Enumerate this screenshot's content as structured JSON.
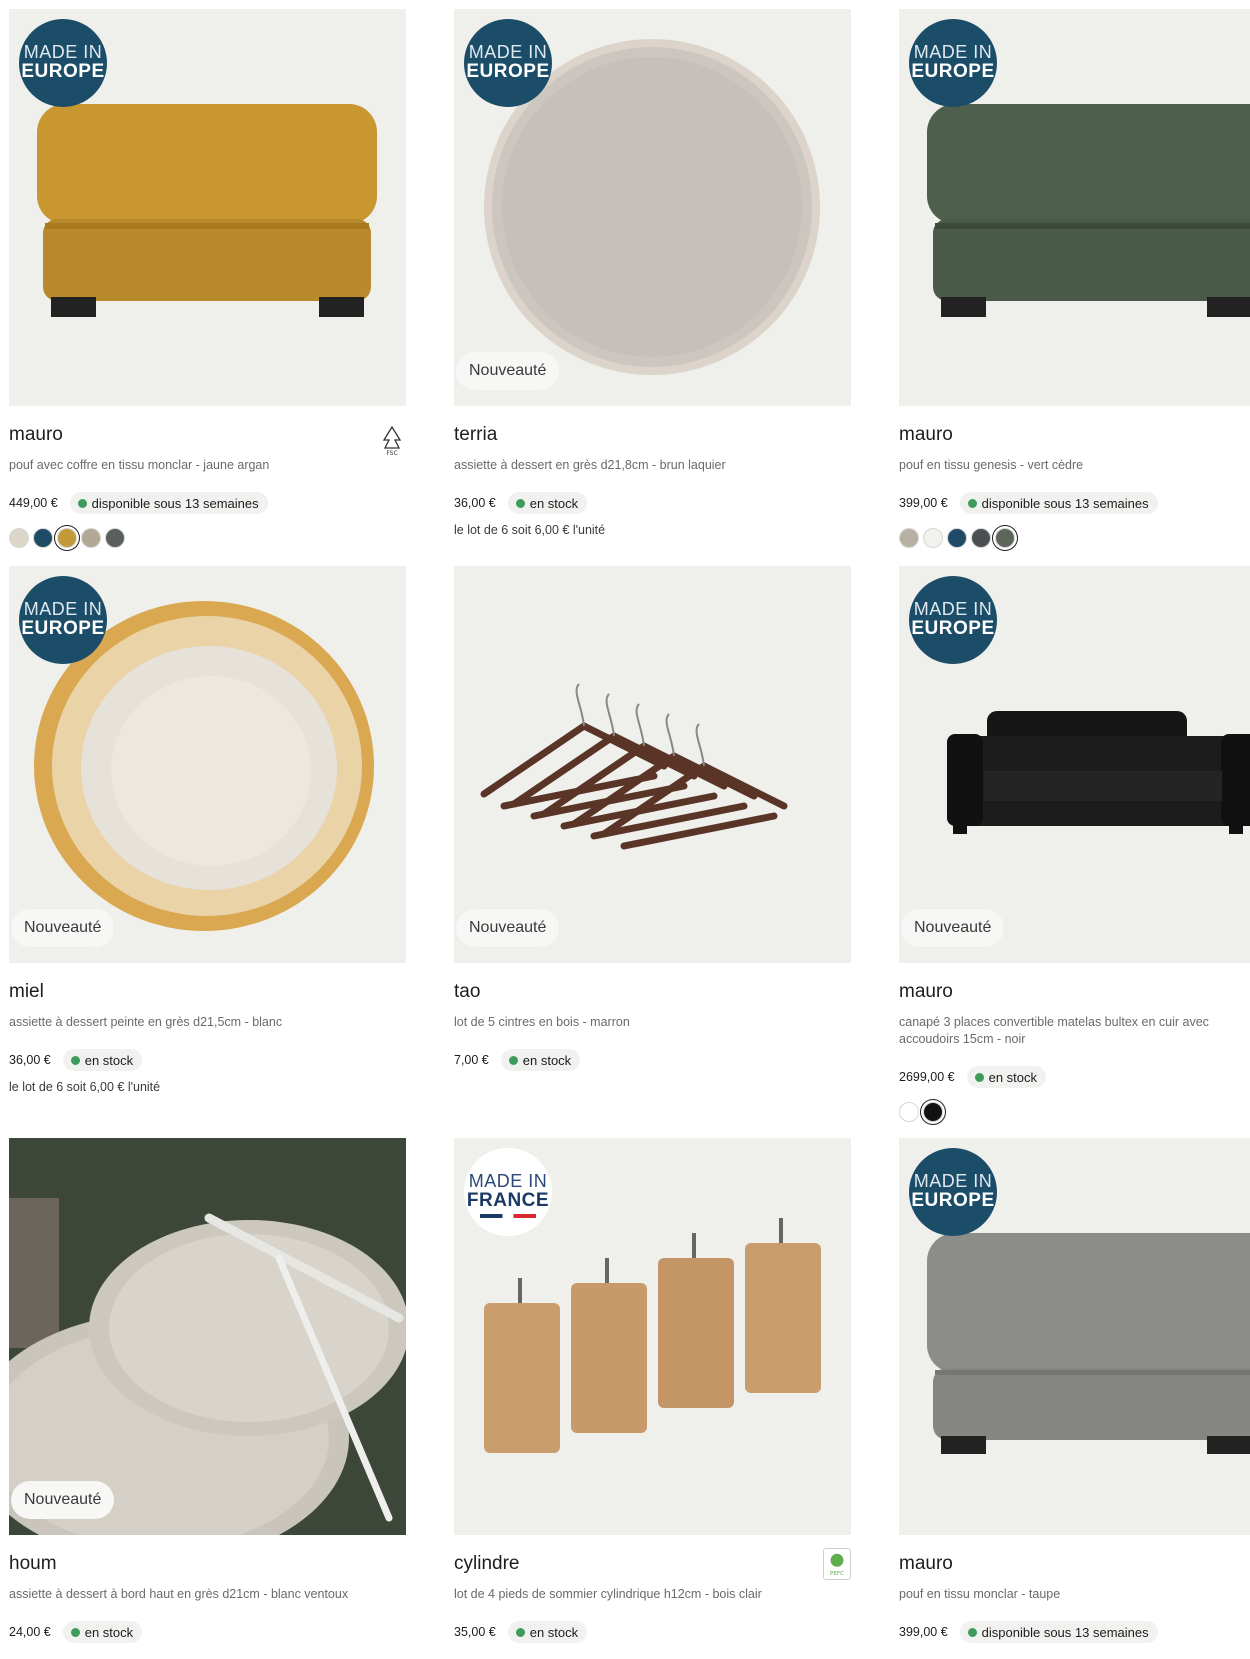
{
  "products": [
    {
      "name": "mauro",
      "description": "pouf avec coffre en tissu monclar - jaune argan",
      "price": "449,00 €",
      "availability": "disponible sous 13 semaines",
      "badge": {
        "line1": "MADE IN",
        "line2": "EUROPE"
      },
      "certification": "FSC",
      "swatches": [
        "#dcd6c8",
        "#1f4b66",
        "#c29a3a",
        "#b3a796",
        "#5a5f5c"
      ],
      "selected_swatch": 2
    },
    {
      "name": "terria",
      "description": "assiette à dessert en grès d21,8cm - brun laquier",
      "price": "36,00 €",
      "availability": "en stock",
      "unit_price": "le lot de 6 soit 6,00 € l'unité",
      "badge": {
        "line1": "MADE IN",
        "line2": "EUROPE"
      },
      "new_label": "Nouveauté"
    },
    {
      "name": "mauro",
      "description": "pouf en tissu genesis - vert cèdre",
      "price": "399,00 €",
      "availability": "disponible sous 13 semaines",
      "badge": {
        "line1": "MADE IN",
        "line2": "EUROPE"
      },
      "swatches": [
        "#b8b0a4",
        "#f4f2ec",
        "#1f4b66",
        "#4a4f52",
        "#5c665a"
      ],
      "selected_swatch": 4
    },
    {
      "name": "miel",
      "description": "assiette à dessert peinte en grès d21,5cm - blanc",
      "price": "36,00 €",
      "availability": "en stock",
      "unit_price": "le lot de 6 soit 6,00 € l'unité",
      "badge": {
        "line1": "MADE IN",
        "line2": "EUROPE"
      },
      "new_label": "Nouveauté"
    },
    {
      "name": "tao",
      "description": "lot de 5 cintres en bois - marron",
      "price": "7,00 €",
      "availability": "en stock",
      "new_label": "Nouveauté"
    },
    {
      "name": "mauro",
      "description": "canapé 3 places convertible matelas bultex en cuir avec accoudoirs 15cm - noir",
      "price": "2699,00 €",
      "availability": "en stock",
      "badge": {
        "line1": "MADE IN",
        "line2": "EUROPE"
      },
      "new_label": "Nouveauté",
      "swatches": [
        "#ffffff",
        "#111111"
      ],
      "selected_swatch": 1
    },
    {
      "name": "houm",
      "description": "assiette à dessert à bord haut en grès d21cm - blanc ventoux",
      "price": "24,00 €",
      "availability": "en stock",
      "new_label": "Nouveauté"
    },
    {
      "name": "cylindre",
      "description": "lot de 4 pieds de sommier cylindrique h12cm - bois clair",
      "price": "35,00 €",
      "availability": "en stock",
      "badge": {
        "line1": "MADE IN",
        "line2": "FRANCE"
      },
      "certification": "PEFC"
    },
    {
      "name": "mauro",
      "description": "pouf en tissu monclar - taupe",
      "price": "399,00 €",
      "availability": "disponible sous 13 semaines",
      "badge": {
        "line1": "MADE IN",
        "line2": "EUROPE"
      }
    }
  ]
}
